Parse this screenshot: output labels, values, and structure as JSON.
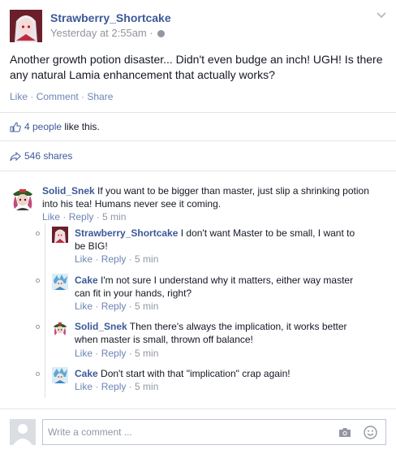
{
  "post": {
    "author": "Strawberry_Shortcake",
    "time": "Yesterday at 2:55am · ",
    "text": "Another growth potion disaster... Didn't even budge an inch! UGH! Is there any natural Lamia enhancement that actually works?",
    "actions": {
      "like": "Like",
      "sep1": " · ",
      "comment": "Comment",
      "sep2": " · ",
      "share": "Share"
    }
  },
  "likes": {
    "count_link": "4 people",
    "suffix": " like this."
  },
  "shares": {
    "label": "546 shares"
  },
  "comments": [
    {
      "author": "Solid_Snek",
      "text": " If you want to be bigger than master, just slip a shrinking potion into his tea! Humans never see it coming.",
      "like": "Like",
      "reply": "Reply",
      "time": "5 min"
    }
  ],
  "replies": [
    {
      "author": "Strawberry_Shortcake",
      "text": " I don't want Master to be small, I want to be BIG!",
      "like": "Like",
      "reply": "Reply",
      "time": "5 min"
    },
    {
      "author": "Cake",
      "text": " I'm not sure I understand why it matters, either way master can fit in your hands, right?",
      "like": "Like",
      "reply": "Reply",
      "time": "5 min"
    },
    {
      "author": "Solid_Snek",
      "text": " Then there's always the implication, it works better when master is small, thrown off balance!",
      "like": "Like",
      "reply": "Reply",
      "time": "5 min"
    },
    {
      "author": "Cake",
      "text": " Don't start with that \"implication\" crap again!",
      "like": "Like",
      "reply": "Reply",
      "time": "5 min"
    }
  ],
  "meta_sep": " · ",
  "composer": {
    "placeholder": "Write a comment ..."
  },
  "colors": {
    "link": "#3b5998",
    "muted": "#9197a3",
    "divider": "#e5e5e5"
  }
}
